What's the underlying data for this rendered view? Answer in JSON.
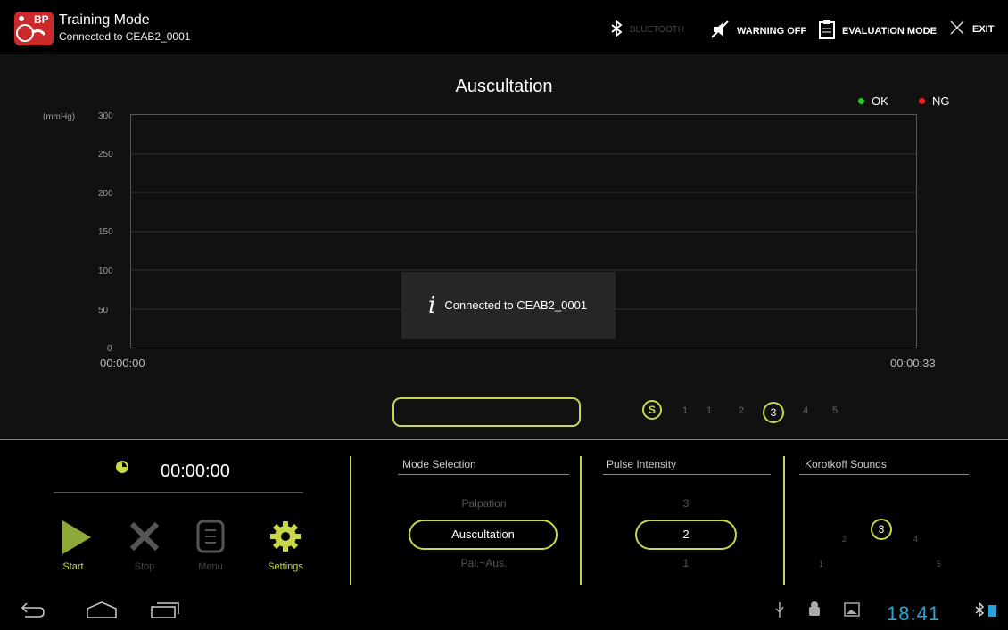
{
  "app": {
    "title": "Training Mode",
    "subtitle": "Connected to CEAB2_0001",
    "logo_text": "BP"
  },
  "topbar": {
    "bluetooth_label": "BLUETOOTH",
    "warning_label": "WARNING OFF",
    "evaluation_label": "EVALUATION MODE",
    "exit_label": "EXIT"
  },
  "chart": {
    "title": "Auscultation",
    "legend": [
      {
        "label": "OK",
        "color": "#22cc22"
      },
      {
        "label": "NG",
        "color": "#ee2222"
      }
    ],
    "ylabel": "(mmHg)",
    "yticks": [
      "300",
      "250",
      "200",
      "150",
      "100",
      "50",
      "0"
    ],
    "x_start": "00:00:00",
    "x_end": "00:00:33",
    "toast": "Connected to CEAB2_0001"
  },
  "chart_data": {
    "type": "line",
    "title": "Auscultation",
    "xlabel": "",
    "ylabel": "(mmHg)",
    "ylim": [
      0,
      300
    ],
    "xlim": [
      "00:00:00",
      "00:00:33"
    ],
    "series": [],
    "grid": true,
    "legend": "top-right"
  },
  "zoom": {
    "icon": "S",
    "levels": [
      "1",
      "1",
      "2",
      "3",
      "4",
      "5"
    ],
    "selected": "3"
  },
  "controls": {
    "timer": "00:00:00",
    "start": "Start",
    "stop": "Stop",
    "menu": "Menu",
    "settings": "Settings"
  },
  "mode_selection": {
    "title": "Mode Selection",
    "options": [
      "Palpation",
      "Auscultation",
      "Pal.~Aus."
    ],
    "selected": "Auscultation"
  },
  "pulse_intensity": {
    "title": "Pulse Intensity",
    "options": [
      "3",
      "2",
      "1"
    ],
    "selected": "2"
  },
  "korotkoff": {
    "title": "Korotkoff Sounds",
    "selected": "3"
  },
  "statusbar": {
    "time": "18:41"
  },
  "colors": {
    "accent": "#c8d84a",
    "clock": "#2aa4d8"
  }
}
